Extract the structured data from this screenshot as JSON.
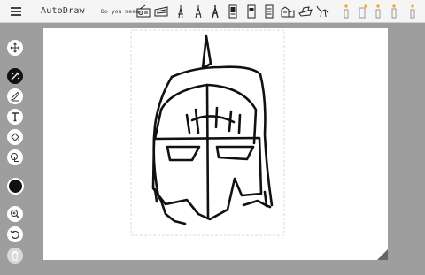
{
  "app": {
    "title": "AutoDraw"
  },
  "suggestions": {
    "label": "Do you mean:",
    "items": [
      {
        "icon": "radio-icon",
        "starred": false
      },
      {
        "icon": "keyboard-icon",
        "starred": false
      },
      {
        "icon": "eiffel-tower-icon",
        "starred": false
      },
      {
        "icon": "eiffel-tower-icon",
        "starred": false
      },
      {
        "icon": "eiffel-tower-icon",
        "starred": false
      },
      {
        "icon": "tablet-icon",
        "starred": false
      },
      {
        "icon": "tablet-icon",
        "starred": false
      },
      {
        "icon": "tablet-icon",
        "starred": false
      },
      {
        "icon": "building-icon",
        "starred": false
      },
      {
        "icon": "boat-icon",
        "starred": false
      },
      {
        "icon": "animal-icon",
        "starred": false
      },
      {
        "icon": "candle-icon",
        "starred": true
      },
      {
        "icon": "candle-icon",
        "starred": true
      },
      {
        "icon": "candle-icon",
        "starred": true
      },
      {
        "icon": "candle-icon",
        "starred": true
      },
      {
        "icon": "candle-icon",
        "starred": true
      }
    ]
  },
  "tools": [
    {
      "name": "move-tool",
      "icon": "move-icon",
      "state": "normal"
    },
    {
      "name": "autodraw-tool",
      "icon": "autodraw-icon",
      "state": "active"
    },
    {
      "name": "draw-tool",
      "icon": "pencil-icon",
      "state": "normal"
    },
    {
      "name": "type-tool",
      "icon": "text-icon",
      "state": "normal"
    },
    {
      "name": "fill-tool",
      "icon": "fill-icon",
      "state": "normal"
    },
    {
      "name": "shape-tool",
      "icon": "shape-icon",
      "state": "normal"
    },
    {
      "name": "color-picker",
      "icon": "color-swatch",
      "state": "normal",
      "color": "#111111"
    },
    {
      "name": "zoom-tool",
      "icon": "zoom-icon",
      "state": "normal"
    },
    {
      "name": "undo-button",
      "icon": "undo-icon",
      "state": "normal"
    },
    {
      "name": "delete-button",
      "icon": "trash-icon",
      "state": "disabled"
    }
  ],
  "colors": {
    "background": "#9e9e9e",
    "topbar": "#f5f5f5",
    "canvas": "#ffffff",
    "ink": "#111111",
    "star": "#f5a623"
  }
}
